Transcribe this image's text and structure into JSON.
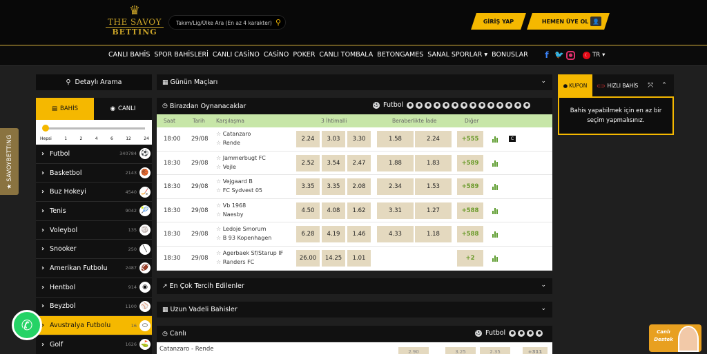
{
  "header": {
    "logo_line1": "THE SAVOY",
    "logo_line2": "BETTING",
    "search_placeholder": "Takım/Lig/Ülke Ara (En az 4 karakter)",
    "login_label": "GİRİŞ YAP",
    "register_label": "HEMEN ÜYE OL"
  },
  "nav": {
    "items": [
      "CANLI BAHİS",
      "SPOR BAHİSLERİ",
      "CANLI CASİNO",
      "CASİNO",
      "POKER",
      "CANLI TOMBALA",
      "BETONGAMES",
      "SANAL SPORLAR ▾",
      "BONUSLAR"
    ],
    "lang": "TR"
  },
  "sidebar": {
    "vertical_tab": "★ SAVOYBETTING",
    "detail_search": "Detaylı Arama",
    "tab_bahis": "BAHİS",
    "tab_canli": "CANLI",
    "slider_labels": [
      "Hepsi",
      "1",
      "2",
      "4",
      "6",
      "12",
      "24"
    ],
    "slider_value_fraction": 0.0,
    "sports": [
      {
        "name": "Futbol",
        "count": "340784",
        "icon": "⚽"
      },
      {
        "name": "Basketbol",
        "count": "2143",
        "icon": "🏀"
      },
      {
        "name": "Buz Hokeyi",
        "count": "4540",
        "icon": "🏒"
      },
      {
        "name": "Tenis",
        "count": "9042",
        "icon": "🎾"
      },
      {
        "name": "Voleybol",
        "count": "135",
        "icon": "🏐"
      },
      {
        "name": "Snooker",
        "count": "250",
        "icon": "╲"
      },
      {
        "name": "Amerikan Futbolu",
        "count": "2487",
        "icon": "🏈"
      },
      {
        "name": "Hentbol",
        "count": "914",
        "icon": "◉"
      },
      {
        "name": "Beyzbol",
        "count": "1100",
        "icon": "⚾"
      },
      {
        "name": "Avustralya Futbolu",
        "count": "16",
        "icon": "⬭"
      },
      {
        "name": "Golf",
        "count": "1626",
        "icon": "⛳"
      }
    ],
    "active_sport_index": 9
  },
  "center": {
    "gunun_maclari": "Günün Maçları",
    "birazdan": "Birazdan Oynanacaklar",
    "filter_label": "Futbol",
    "columns": {
      "saat": "Saat",
      "tarih": "Tarih",
      "karsilasma": "Karşılaşma",
      "ihtimal": "3 İhtimalli",
      "beraberlik": "Beraberlikte İade",
      "diger": "Diğer"
    },
    "matches": [
      {
        "time": "18:00",
        "date": "29/08",
        "home": "Catanzaro",
        "away": "Rende",
        "o1": "2.24",
        "o2": "3.03",
        "o3": "3.30",
        "b1": "1.58",
        "b2": "2.24",
        "more": "+555",
        "live_tv": true
      },
      {
        "time": "18:30",
        "date": "29/08",
        "home": "Jammerbugt FC",
        "away": "Vejle",
        "o1": "2.52",
        "o2": "3.54",
        "o3": "2.47",
        "b1": "1.88",
        "b2": "1.83",
        "more": "+589",
        "live_tv": false
      },
      {
        "time": "18:30",
        "date": "29/08",
        "home": "Vejgaard B",
        "away": "FC Sydvest 05",
        "o1": "3.35",
        "o2": "3.35",
        "o3": "2.08",
        "b1": "2.34",
        "b2": "1.53",
        "more": "+589",
        "live_tv": false
      },
      {
        "time": "18:30",
        "date": "29/08",
        "home": "Vb 1968",
        "away": "Naesby",
        "o1": "4.50",
        "o2": "4.08",
        "o3": "1.62",
        "b1": "3.31",
        "b2": "1.27",
        "more": "+588",
        "live_tv": false
      },
      {
        "time": "18:30",
        "date": "29/08",
        "home": "Ledoje Smorum",
        "away": "B 93 Kopenhagen",
        "o1": "6.28",
        "o2": "4.19",
        "o3": "1.46",
        "b1": "4.33",
        "b2": "1.18",
        "more": "+588",
        "live_tv": false
      },
      {
        "time": "18:30",
        "date": "29/08",
        "home": "Agerbaek Sf/Starup IF",
        "away": "Randers FC",
        "o1": "26.00",
        "o2": "14.25",
        "o3": "1.01",
        "b1": "",
        "b2": "",
        "more": "+2",
        "live_tv": false
      }
    ],
    "cok_tercih": "En Çok Tercih Edilenler",
    "uzun_vadeli": "Uzun Vadeli Bahisler",
    "canli": "Canlı",
    "canli_match": "Catanzaro - Rende",
    "canli_odds": [
      "2.90",
      "3.25",
      "2.35",
      "+311"
    ]
  },
  "coupon": {
    "tab_kupon": "KUPON",
    "tab_hizli": "HIZLI BAHİS",
    "message": "Bahis yapabilmek için en az bir seçim yapmalısınız."
  },
  "live_support": {
    "label_line1": "Canlı",
    "label_line2": "Destek"
  },
  "colors": {
    "accent": "#f5b800",
    "gold": "#c9a227",
    "table_header": "#c7e6a8",
    "odd_bg": "#e4d9bf"
  }
}
